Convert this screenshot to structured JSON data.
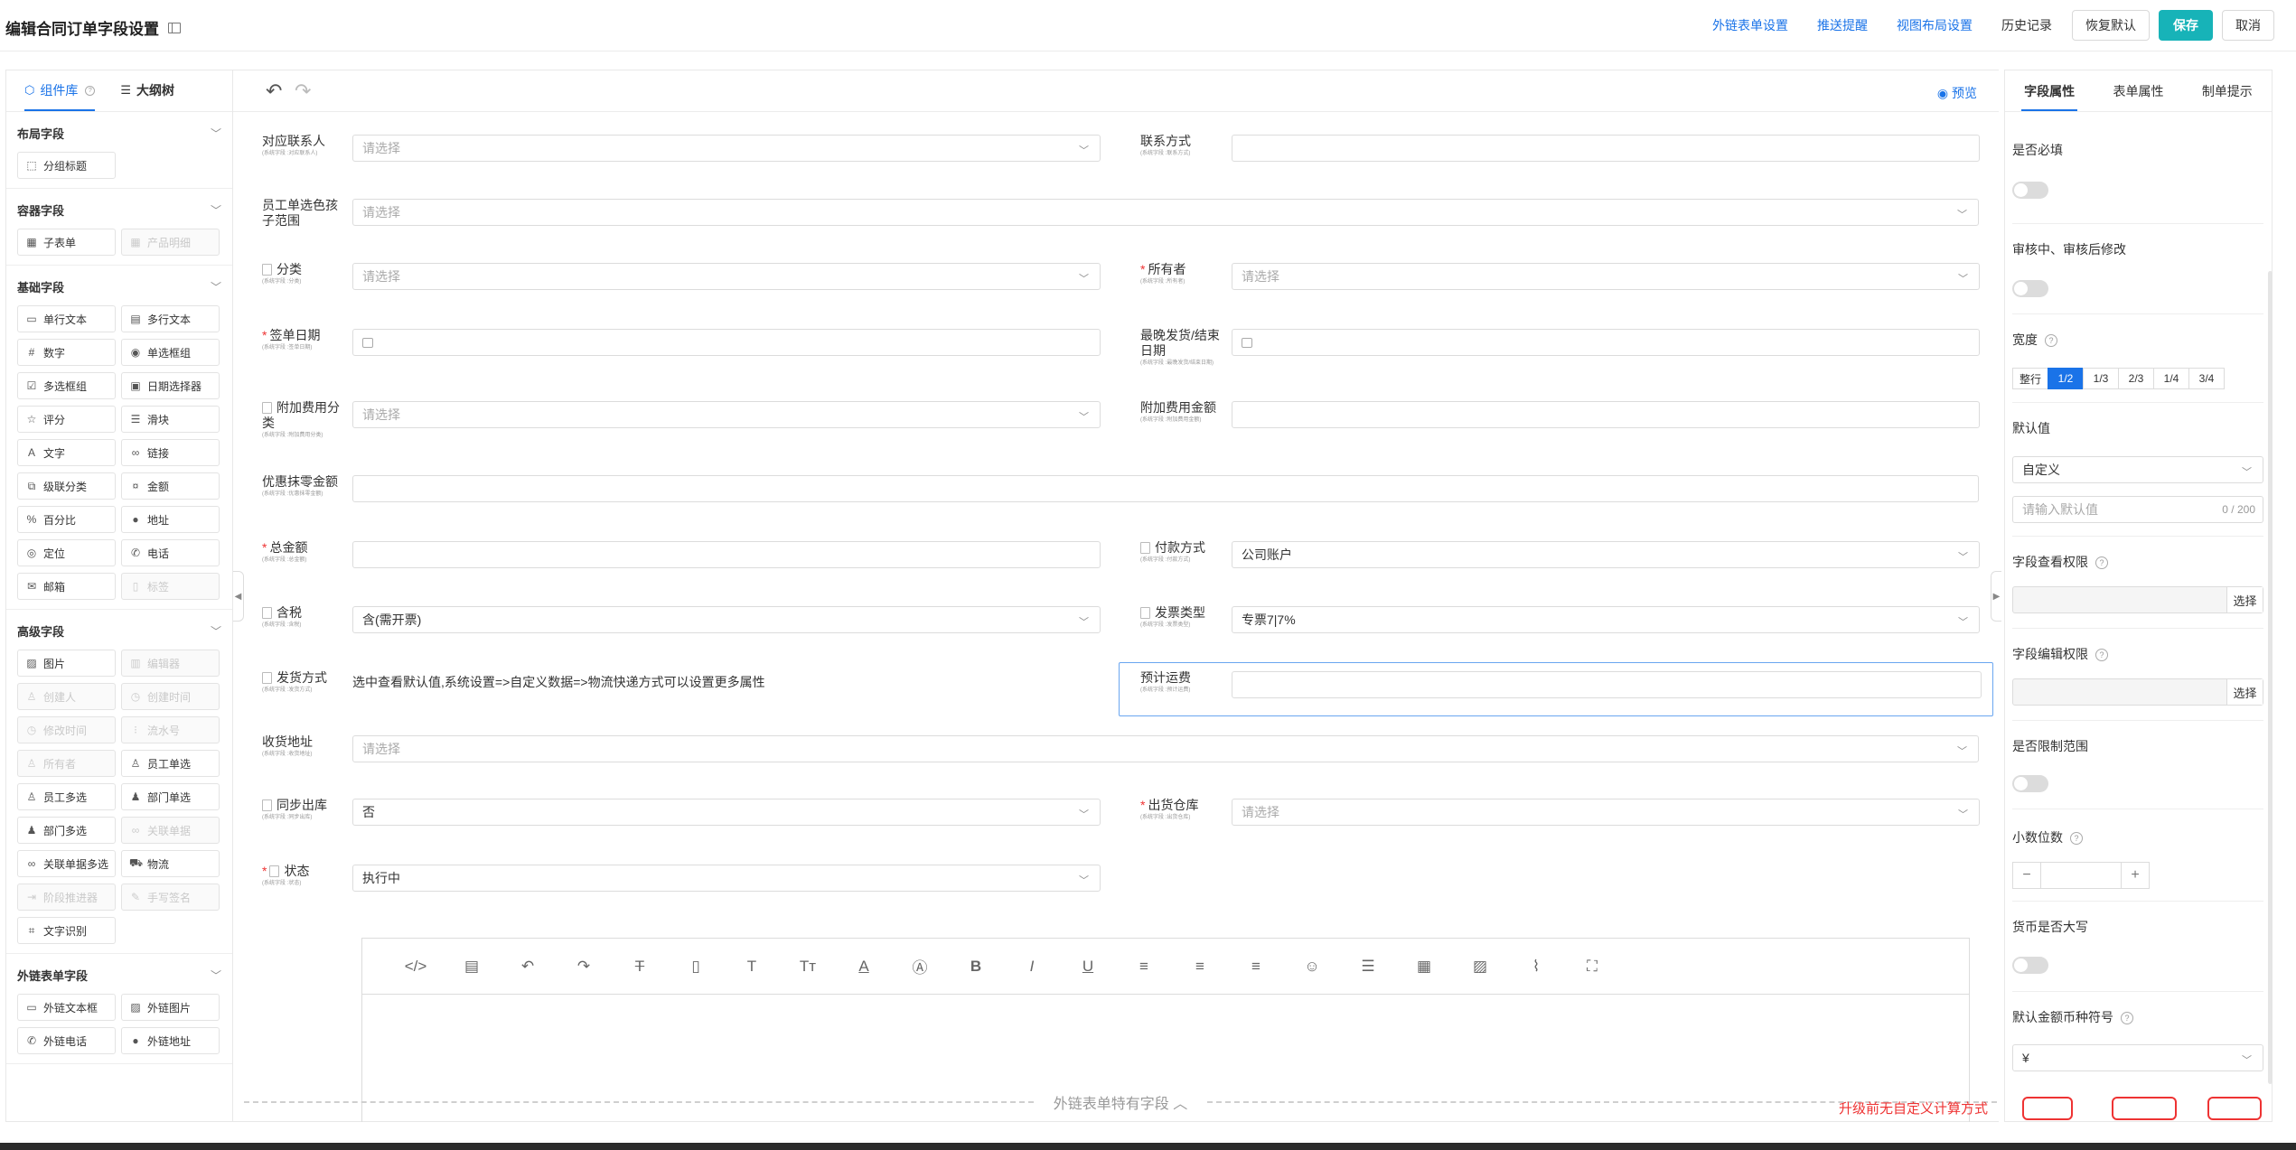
{
  "header": {
    "title": "编辑合同订单字段设置",
    "links": [
      "外链表单设置",
      "推送提醒",
      "视图布局设置"
    ],
    "history": "历史记录",
    "restore": "恢复默认",
    "save": "保存",
    "cancel": "取消"
  },
  "left_panel": {
    "tabs": [
      "组件库",
      "大纲树"
    ],
    "groups": [
      {
        "title": "布局字段",
        "items": [
          {
            "label": "分组标题",
            "icon": "layout-icon",
            "disabled": false
          }
        ]
      },
      {
        "title": "容器字段",
        "items": [
          {
            "label": "子表单",
            "icon": "table-icon",
            "disabled": false
          },
          {
            "label": "产品明细",
            "icon": "table-icon",
            "disabled": true
          }
        ]
      },
      {
        "title": "基础字段",
        "items": [
          {
            "label": "单行文本",
            "icon": "input-icon",
            "disabled": false
          },
          {
            "label": "多行文本",
            "icon": "textarea-icon",
            "disabled": false
          },
          {
            "label": "数字",
            "icon": "number-icon",
            "disabled": false
          },
          {
            "label": "单选框组",
            "icon": "radio-icon",
            "disabled": false
          },
          {
            "label": "多选框组",
            "icon": "checkbox-icon",
            "disabled": false
          },
          {
            "label": "日期选择器",
            "icon": "calendar-icon",
            "disabled": false
          },
          {
            "label": "评分",
            "icon": "star-icon",
            "disabled": false
          },
          {
            "label": "滑块",
            "icon": "slider-icon",
            "disabled": false
          },
          {
            "label": "文字",
            "icon": "text-icon",
            "disabled": false
          },
          {
            "label": "链接",
            "icon": "link-icon",
            "disabled": false
          },
          {
            "label": "级联分类",
            "icon": "cascade-icon",
            "disabled": false
          },
          {
            "label": "金额",
            "icon": "money-icon",
            "disabled": false
          },
          {
            "label": "百分比",
            "icon": "percent-icon",
            "disabled": false
          },
          {
            "label": "地址",
            "icon": "pin-icon",
            "disabled": false
          },
          {
            "label": "定位",
            "icon": "locate-icon",
            "disabled": false
          },
          {
            "label": "电话",
            "icon": "phone-icon",
            "disabled": false
          },
          {
            "label": "邮箱",
            "icon": "mail-icon",
            "disabled": false
          },
          {
            "label": "标签",
            "icon": "tag-icon",
            "disabled": true
          }
        ]
      },
      {
        "title": "高级字段",
        "items": [
          {
            "label": "图片",
            "icon": "image-icon",
            "disabled": false
          },
          {
            "label": "编辑器",
            "icon": "editor-icon",
            "disabled": true
          },
          {
            "label": "创建人",
            "icon": "user-icon",
            "disabled": true
          },
          {
            "label": "创建时间",
            "icon": "clock-icon",
            "disabled": true
          },
          {
            "label": "修改时间",
            "icon": "clock-icon",
            "disabled": true
          },
          {
            "label": "流水号",
            "icon": "serial-icon",
            "disabled": true
          },
          {
            "label": "所有者",
            "icon": "user-icon",
            "disabled": true
          },
          {
            "label": "员工单选",
            "icon": "user-icon",
            "disabled": false
          },
          {
            "label": "员工多选",
            "icon": "users-icon",
            "disabled": false
          },
          {
            "label": "部门单选",
            "icon": "dept-icon",
            "disabled": false
          },
          {
            "label": "部门多选",
            "icon": "dept-icon",
            "disabled": false
          },
          {
            "label": "关联单据",
            "icon": "link-icon",
            "disabled": true
          },
          {
            "label": "关联单据多选",
            "icon": "link-icon",
            "disabled": false
          },
          {
            "label": "物流",
            "icon": "truck-icon",
            "disabled": false
          },
          {
            "label": "阶段推进器",
            "icon": "stage-icon",
            "disabled": true
          },
          {
            "label": "手写签名",
            "icon": "sign-icon",
            "disabled": true
          },
          {
            "label": "文字识别",
            "icon": "ocr-icon",
            "disabled": false
          }
        ]
      },
      {
        "title": "外链表单字段",
        "items": [
          {
            "label": "外链文本框",
            "icon": "input-icon",
            "disabled": false
          },
          {
            "label": "外链图片",
            "icon": "image-icon",
            "disabled": false
          },
          {
            "label": "外链电话",
            "icon": "phone-icon",
            "disabled": false
          },
          {
            "label": "外链地址",
            "icon": "pin-icon",
            "disabled": false
          }
        ]
      }
    ]
  },
  "canvas": {
    "preview": "预览",
    "fields": [
      {
        "label": "对应联系人",
        "sub": "(系统字段 :对应联系人)",
        "value": "请选择",
        "placeholder": true,
        "kind": "select",
        "required": false,
        "lock": false
      },
      {
        "label": "联系方式",
        "sub": "(系统字段 :联系方式)",
        "value": "",
        "placeholder": false,
        "kind": "text",
        "required": false,
        "lock": false
      },
      {
        "label": "员工单选色孩子范围",
        "sub": "",
        "value": "请选择",
        "placeholder": true,
        "kind": "select",
        "required": false,
        "lock": false
      },
      {
        "label": "分类",
        "sub": "(系统字段 :分类)",
        "value": "请选择",
        "placeholder": true,
        "kind": "select",
        "required": false,
        "lock": true
      },
      {
        "label": "所有者",
        "sub": "(系统字段 :所有者)",
        "value": "请选择",
        "placeholder": true,
        "kind": "select",
        "required": true,
        "lock": false
      },
      {
        "label": "签单日期",
        "sub": "(系统字段 :签单日期)",
        "value": "",
        "placeholder": false,
        "kind": "date",
        "required": true,
        "lock": false
      },
      {
        "label": "最晚发货/结束日期",
        "sub": "(系统字段 :最晚发货/结束日期)",
        "value": "",
        "placeholder": false,
        "kind": "date",
        "required": false,
        "lock": false
      },
      {
        "label": "附加费用分类",
        "sub": "(系统字段 :附加费用分类)",
        "value": "请选择",
        "placeholder": true,
        "kind": "select",
        "required": false,
        "lock": true
      },
      {
        "label": "附加费用金额",
        "sub": "(系统字段 :附加费用金额)",
        "value": "",
        "placeholder": false,
        "kind": "text",
        "required": false,
        "lock": false
      },
      {
        "label": "优惠抹零金额",
        "sub": "(系统字段 :优惠抹零金额)",
        "value": "",
        "placeholder": false,
        "kind": "text",
        "required": false,
        "lock": false
      },
      {
        "label": "总金额",
        "sub": "(系统字段 :总金额)",
        "value": "",
        "placeholder": false,
        "kind": "text",
        "required": true,
        "lock": false
      },
      {
        "label": "付款方式",
        "sub": "(系统字段 :付款方式)",
        "value": "公司账户",
        "placeholder": false,
        "kind": "select",
        "required": false,
        "lock": true
      },
      {
        "label": "含税",
        "sub": "(系统字段 :含税)",
        "value": "含(需开票)",
        "placeholder": false,
        "kind": "select",
        "required": false,
        "lock": true
      },
      {
        "label": "发票类型",
        "sub": "(系统字段 :发票类型)",
        "value": "专票7|7%",
        "placeholder": false,
        "kind": "select",
        "required": false,
        "lock": true
      },
      {
        "label": "发货方式",
        "sub": "(系统字段 :发货方式)",
        "value": "选中查看默认值,系统设置=>自定义数据=>物流快递方式可以设置更多属性",
        "placeholder": false,
        "kind": "note",
        "required": false,
        "lock": true
      },
      {
        "label": "预计运费",
        "sub": "(系统字段 :预计运费)",
        "value": "",
        "placeholder": false,
        "kind": "text",
        "required": false,
        "lock": false
      },
      {
        "label": "收货地址",
        "sub": "(系统字段 :收货地址)",
        "value": "请选择",
        "placeholder": true,
        "kind": "select",
        "required": false,
        "lock": false
      },
      {
        "label": "同步出库",
        "sub": "(系统字段 :同步出库)",
        "value": "否",
        "placeholder": false,
        "kind": "select",
        "required": false,
        "lock": true
      },
      {
        "label": "出货仓库",
        "sub": "(系统字段 :出货仓库)",
        "value": "请选择",
        "placeholder": true,
        "kind": "select",
        "required": true,
        "lock": false
      },
      {
        "label": "状态",
        "sub": "(系统字段 :状态)",
        "value": "执行中",
        "placeholder": false,
        "kind": "select",
        "required": true,
        "lock": true
      }
    ],
    "ext_section": "外链表单特有字段",
    "upgrade_note": "升级前无自定义计算方式"
  },
  "right_panel": {
    "tabs": [
      "字段属性",
      "表单属性",
      "制单提示"
    ],
    "required_label": "是否必填",
    "edit_label": "审核中、审核后修改",
    "width_label": "宽度",
    "width_options": [
      "整行",
      "1/2",
      "1/3",
      "2/3",
      "1/4",
      "3/4"
    ],
    "width_selected": "1/2",
    "default_label": "默认值",
    "default_mode": "自定义",
    "default_placeholder": "请输入默认值",
    "default_count": "0 / 200",
    "view_perm_label": "字段查看权限",
    "edit_perm_label": "字段编辑权限",
    "choose": "选择",
    "range_label": "是否限制范围",
    "decimal_label": "小数位数",
    "currency_upper_label": "货币是否大写",
    "currency_symbol_label": "默认金额币种符号",
    "currency_symbol": "¥"
  },
  "colors": {
    "accent": "#1a73e8",
    "primary_button": "#17b3b8",
    "required": "#e33333"
  }
}
